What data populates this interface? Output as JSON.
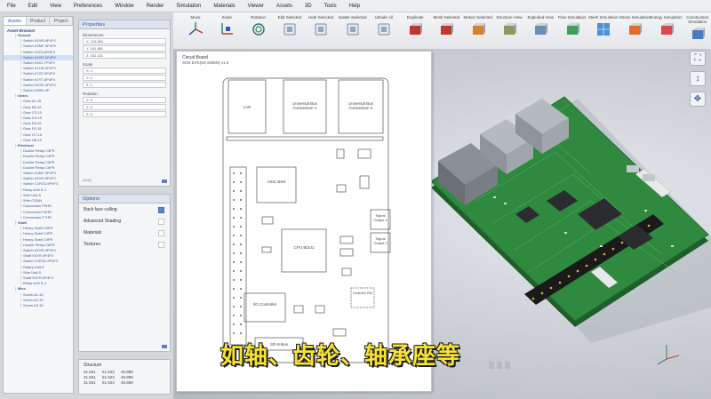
{
  "menubar": [
    "File",
    "Edit",
    "View",
    "Preferences",
    "Window",
    "Render",
    "Simulation",
    "Materials",
    "Viewer",
    "Assets",
    "3D",
    "Tools",
    "Help"
  ],
  "ribbon": [
    {
      "label": "Move",
      "icon": "move-axes-icon"
    },
    {
      "label": "Scale",
      "icon": "scale-axes-icon"
    },
    {
      "label": "Rotation",
      "icon": "rotate-icon"
    },
    {
      "label": "Edit Selected",
      "icon": "edit-selected-icon"
    },
    {
      "label": "Hide Selected",
      "icon": "hide-selected-icon"
    },
    {
      "label": "Isolate Selected",
      "icon": "isolate-selected-icon"
    },
    {
      "label": "Unhide All",
      "icon": "unhide-all-icon"
    },
    {
      "label": "Duplicate",
      "icon": "duplicate-icon"
    },
    {
      "label": "Mesh Selected",
      "icon": "mesh-selected-icon"
    },
    {
      "label": "Motion Selected",
      "icon": "motion-selected-icon"
    },
    {
      "label": "Structure View",
      "icon": "structure-view-icon"
    },
    {
      "label": "Exploded View",
      "icon": "exploded-view-icon"
    },
    {
      "label": "Flow Simulation",
      "icon": "flow-simulation-icon"
    },
    {
      "label": "Mesh Simulation",
      "icon": "mesh-simulation-icon"
    },
    {
      "label": "Stress Simulation",
      "icon": "stress-simulation-icon"
    },
    {
      "label": "Energy Simulation",
      "icon": "energy-simulation-icon"
    },
    {
      "label": "Construction Simulation",
      "icon": "construction-simulation-icon"
    }
  ],
  "assets": {
    "tabs": [
      "Assets",
      "Product",
      "Project"
    ],
    "title": "Asset Browser",
    "groups": [
      {
        "name": "Ground",
        "items": [
          "Switch K5YR-9P4FX",
          "Switch K2MF-3P4FX",
          "Switch K3OJ-6P4FX",
          "Switch K3YR-1P4FX",
          "Switch K5XJ-7P4FX",
          "Switch K1LM-2P4FX",
          "Switch K7ZZ-9P4FX",
          "Switch K2YT-8P4FX",
          "Switch K5YR-4P4FX",
          "Switch K8SN-9P"
        ]
      },
      {
        "name": "Gears",
        "items": [
          "Gear A1-15",
          "Gear B2-15",
          "Gear C3-15",
          "Gear D4-15",
          "Gear E5-15",
          "Gear F6-15",
          "Gear G7-15",
          "Gear H8-15"
        ]
      },
      {
        "name": "Electrical",
        "items": [
          "Double Relay C3FR",
          "Double Relay C4FR",
          "Double Relay C5FR",
          "Double Relay C6FR",
          "Switch K2MF-3P4FX",
          "Switch K5YR-9P4FX",
          "Switch C1R1D-9P4FX",
          "Relay-Unit D-1",
          "Wire Unit-5",
          "Wire CONN",
          "Connection F5HR",
          "Connection F6HR",
          "Connection F7HR"
        ]
      },
      {
        "name": "Shaft",
        "items": [
          "Heavy Shaft C3FR",
          "Heavy Shaft C4FR",
          "Heavy Shaft C5FR",
          "Double Relay C6FR",
          "Switch K5YR-9P4FX",
          "Shaft K5YR-9P4FX",
          "Switch C1R1D-9P4FX",
          "Rotary Unit-5",
          "Wire Unit-5",
          "Shaft K5YR-9P4FX",
          "Relay-Unit D-1"
        ]
      },
      {
        "name": "Misc",
        "items": [
          "Screw A1-15",
          "Screw A2-15",
          "Screw A3-15"
        ]
      }
    ]
  },
  "properties": {
    "title": "Properties",
    "sections": [
      {
        "label": "Dimensions",
        "fields": [
          "X: 104.961",
          "Y: 181.881",
          "Z: 181.131"
        ]
      },
      {
        "label": "Scale",
        "fields": [
          "X: 1",
          "Y: 1",
          "Z: 1"
        ]
      },
      {
        "label": "Rotation",
        "fields": [
          "X: 0",
          "Y: 0",
          "Z: 0"
        ]
      }
    ],
    "footer": "(Unit)"
  },
  "options": {
    "title": "Options",
    "rows": [
      {
        "label": "Back face culling",
        "checked": true
      },
      {
        "label": "Advanced Shading",
        "checked": false
      },
      {
        "label": "Materials",
        "checked": false
      },
      {
        "label": "Textures",
        "checked": false
      }
    ]
  },
  "structure": {
    "title": "Structure",
    "rows": [
      "31.551  51.523  45.889",
      "31.551  51.523  45.889",
      "31.551  51.523  45.889"
    ]
  },
  "board": {
    "title": "Circuit Board",
    "subtitle": "SOK EVK(94-1908N) v1.0",
    "labels": {
      "lan": "LAN",
      "usb1": "Universal Bus Connection 1",
      "usb2": "Universal Bus Connection 2",
      "asic": "ASIC BSN",
      "cpu": "CPU BDU1",
      "io": "I/O Controller",
      "sig1": "Signal Output 1",
      "sig2": "Signal Output 2",
      "ctrl": "Controller RAI",
      "sd": "SD-Imbus"
    }
  },
  "subtitle": "如轴、齿轮、轴承座等",
  "colors": {
    "accent": "#2a5dab",
    "pcb": "#2f8a3f",
    "subtitle": "#f7e23a"
  }
}
